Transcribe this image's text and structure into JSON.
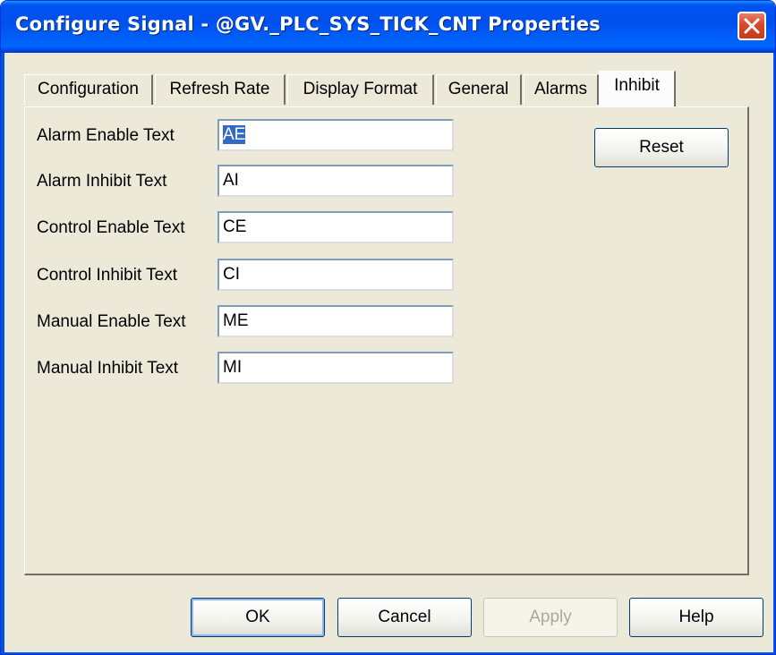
{
  "window": {
    "title": "Configure Signal - @GV._PLC_SYS_TICK_CNT Properties",
    "close_icon": "close-icon"
  },
  "tabs": [
    {
      "label": "Configuration",
      "active": false
    },
    {
      "label": "Refresh Rate",
      "active": false
    },
    {
      "label": "Display Format",
      "active": false
    },
    {
      "label": "General",
      "active": false
    },
    {
      "label": "Alarms",
      "active": false
    },
    {
      "label": "Inhibit",
      "active": true
    }
  ],
  "inhibit": {
    "fields": [
      {
        "label": "Alarm Enable Text",
        "value": "AE",
        "selected": true
      },
      {
        "label": "Alarm Inhibit Text",
        "value": "AI"
      },
      {
        "label": "Control Enable Text",
        "value": "CE"
      },
      {
        "label": "Control Inhibit Text",
        "value": "CI"
      },
      {
        "label": "Manual Enable Text",
        "value": "ME"
      },
      {
        "label": "Manual Inhibit Text",
        "value": "MI"
      }
    ],
    "reset_label": "Reset"
  },
  "footer": {
    "ok_label": "OK",
    "cancel_label": "Cancel",
    "apply_label": "Apply",
    "apply_enabled": false,
    "help_label": "Help"
  },
  "colors": {
    "title_bar": "#0055e5",
    "dialog_bg": "#ece9d8",
    "selection": "#316ac5",
    "close_button": "#d8492a"
  }
}
